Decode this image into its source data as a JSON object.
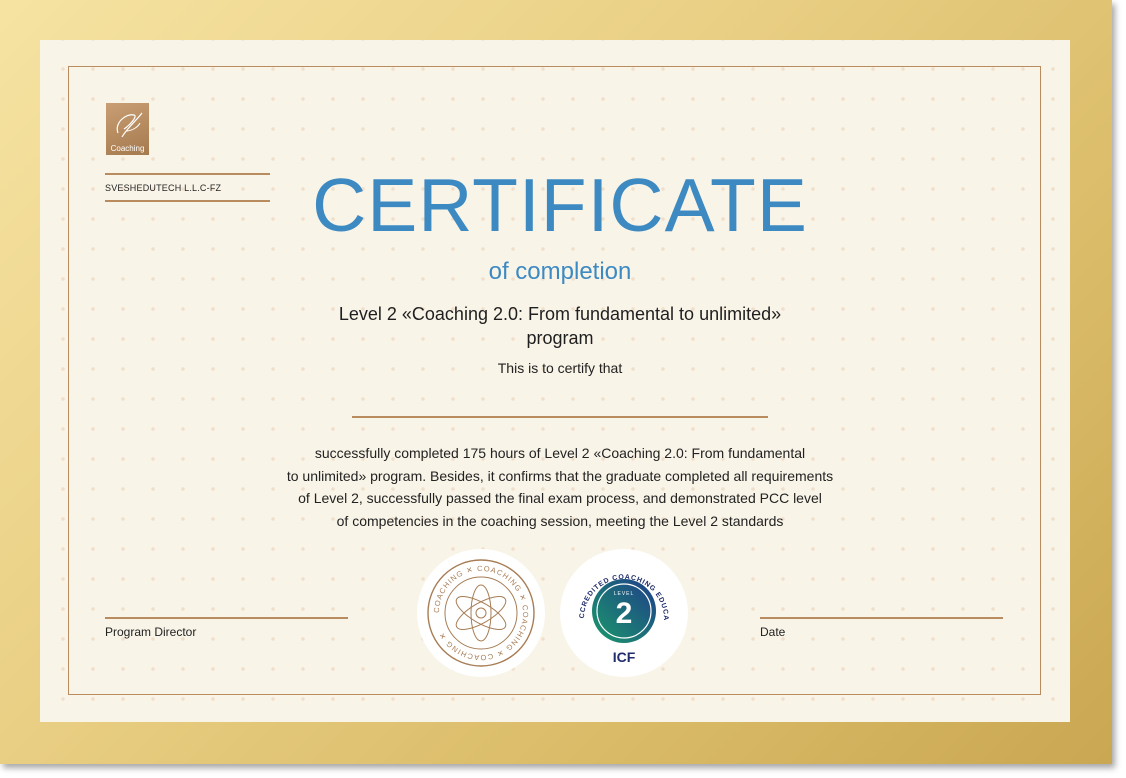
{
  "logo": {
    "text": "Coaching"
  },
  "company": "SVESHEDUTECH L.L.C-FZ",
  "title": "CERTIFICATE",
  "subtitle": "of completion",
  "program": {
    "line1": "Level 2 «Coaching 2.0: From fundamental to unlimited»",
    "line2": "program"
  },
  "certify_text": "This is to certify that",
  "body": {
    "line1": "successfully completed 175 hours of Level 2 «Coaching 2.0: From fundamental",
    "line2": "to unlimited» program. Besides, it confirms that the graduate completed all requirements",
    "line3": "of Level 2, successfully passed the final exam process, and demonstrated PCC level",
    "line4": "of competencies in the coaching session, meeting the Level 2 standards"
  },
  "signatures": {
    "left_label": "Program Director",
    "right_label": "Date"
  },
  "seal_coaching": {
    "text": "COACHING ✕ COACHING ✕ COACHING ✕ COACHING ✕ "
  },
  "seal_icf": {
    "arc_text": "ICF ACCREDITED COACHING EDUCATION",
    "level_label": "LEVEL",
    "level_number": "2",
    "brand": "ICF"
  },
  "colors": {
    "accent_blue": "#3d8ac2",
    "gold": "#b88c5f",
    "paper": "#f9f4e8",
    "icf_navy": "#1f2d6b",
    "icf_green": "#1a9a6a"
  }
}
